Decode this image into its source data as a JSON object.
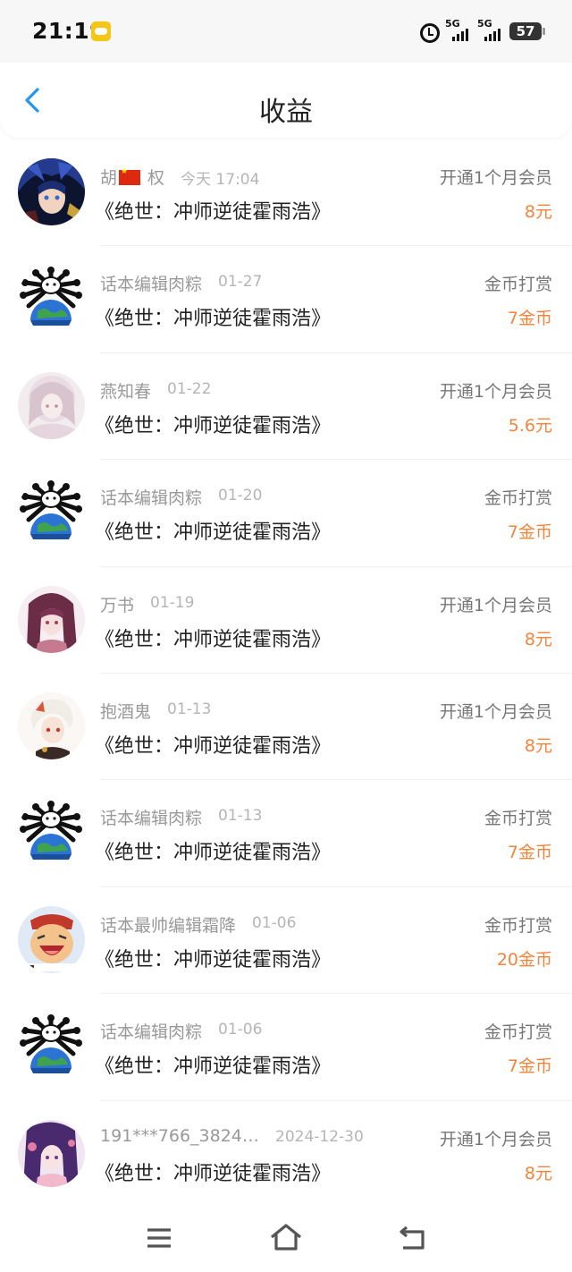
{
  "status_bar": {
    "time": "21:19",
    "signal1": "5G",
    "signal2": "5G",
    "battery": "57"
  },
  "header": {
    "title": "收益"
  },
  "items": [
    {
      "name_before_flag": "胡",
      "name_after_flag": " 权",
      "has_flag": true,
      "time": "今天 17:04",
      "book": "《绝世：冲师逆徒霍雨浩》",
      "action": "开通1个月会员",
      "amount": "8元",
      "avatar": "anime-blue"
    },
    {
      "name": "话本编辑肉粽",
      "time": "01-27",
      "book": "《绝世：冲师逆徒霍雨浩》",
      "action": "金币打赏",
      "amount": "7金币",
      "avatar": "earth"
    },
    {
      "name": "燕知春",
      "time": "01-22",
      "book": "《绝世：冲师逆徒霍雨浩》",
      "action": "开通1个月会员",
      "amount": "5.6元",
      "avatar": "anime-pale"
    },
    {
      "name": "话本编辑肉粽",
      "time": "01-20",
      "book": "《绝世：冲师逆徒霍雨浩》",
      "action": "金币打赏",
      "amount": "7金币",
      "avatar": "earth"
    },
    {
      "name": "万书",
      "time": "01-19",
      "book": "《绝世：冲师逆徒霍雨浩》",
      "action": "开通1个月会员",
      "amount": "8元",
      "avatar": "anime-pink"
    },
    {
      "name": "抱酒鬼",
      "time": "01-13",
      "book": "《绝世：冲师逆徒霍雨浩》",
      "action": "开通1个月会员",
      "amount": "8元",
      "avatar": "anime-white"
    },
    {
      "name": "话本编辑肉粽",
      "time": "01-13",
      "book": "《绝世：冲师逆徒霍雨浩》",
      "action": "金币打赏",
      "amount": "7金币",
      "avatar": "earth"
    },
    {
      "name": "话本最帅编辑霜降",
      "time": "01-06",
      "book": "《绝世：冲师逆徒霍雨浩》",
      "action": "金币打赏",
      "amount": "20金币",
      "avatar": "cartoon"
    },
    {
      "name": "话本编辑肉粽",
      "time": "01-06",
      "book": "《绝世：冲师逆徒霍雨浩》",
      "action": "金币打赏",
      "amount": "7金币",
      "avatar": "earth"
    },
    {
      "name": "191***766_3824…",
      "time": "2024-12-30",
      "book": "《绝世：冲师逆徒霍雨浩》",
      "action": "开通1个月会员",
      "amount": "8元",
      "avatar": "anime-purple"
    }
  ]
}
